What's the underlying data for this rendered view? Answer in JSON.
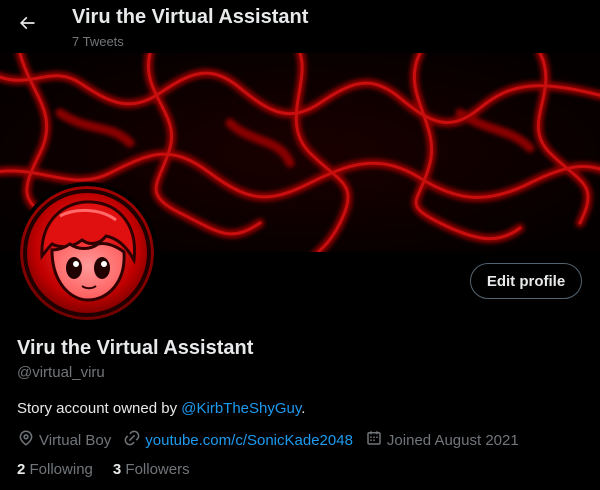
{
  "header": {
    "title": "Viru the Virtual Assistant",
    "subtitle": "7 Tweets",
    "back_icon": "arrow-left-icon"
  },
  "profile": {
    "name": "Viru the Virtual Assistant",
    "handle": "@virtual_viru",
    "bio_prefix": "Story account owned by ",
    "bio_mention": "@KirbTheShyGuy",
    "bio_suffix": ".",
    "edit_label": "Edit profile",
    "location": "Virtual Boy",
    "website": "youtube.com/c/SonicKade2048",
    "joined": "Joined August 2021",
    "following_count": "2",
    "following_label": "Following",
    "followers_count": "3",
    "followers_label": "Followers"
  },
  "colors": {
    "background": "#000000",
    "text": "#e7e9ea",
    "muted": "#71767b",
    "link": "#1d9bf0",
    "banner_red": "#b00000"
  }
}
